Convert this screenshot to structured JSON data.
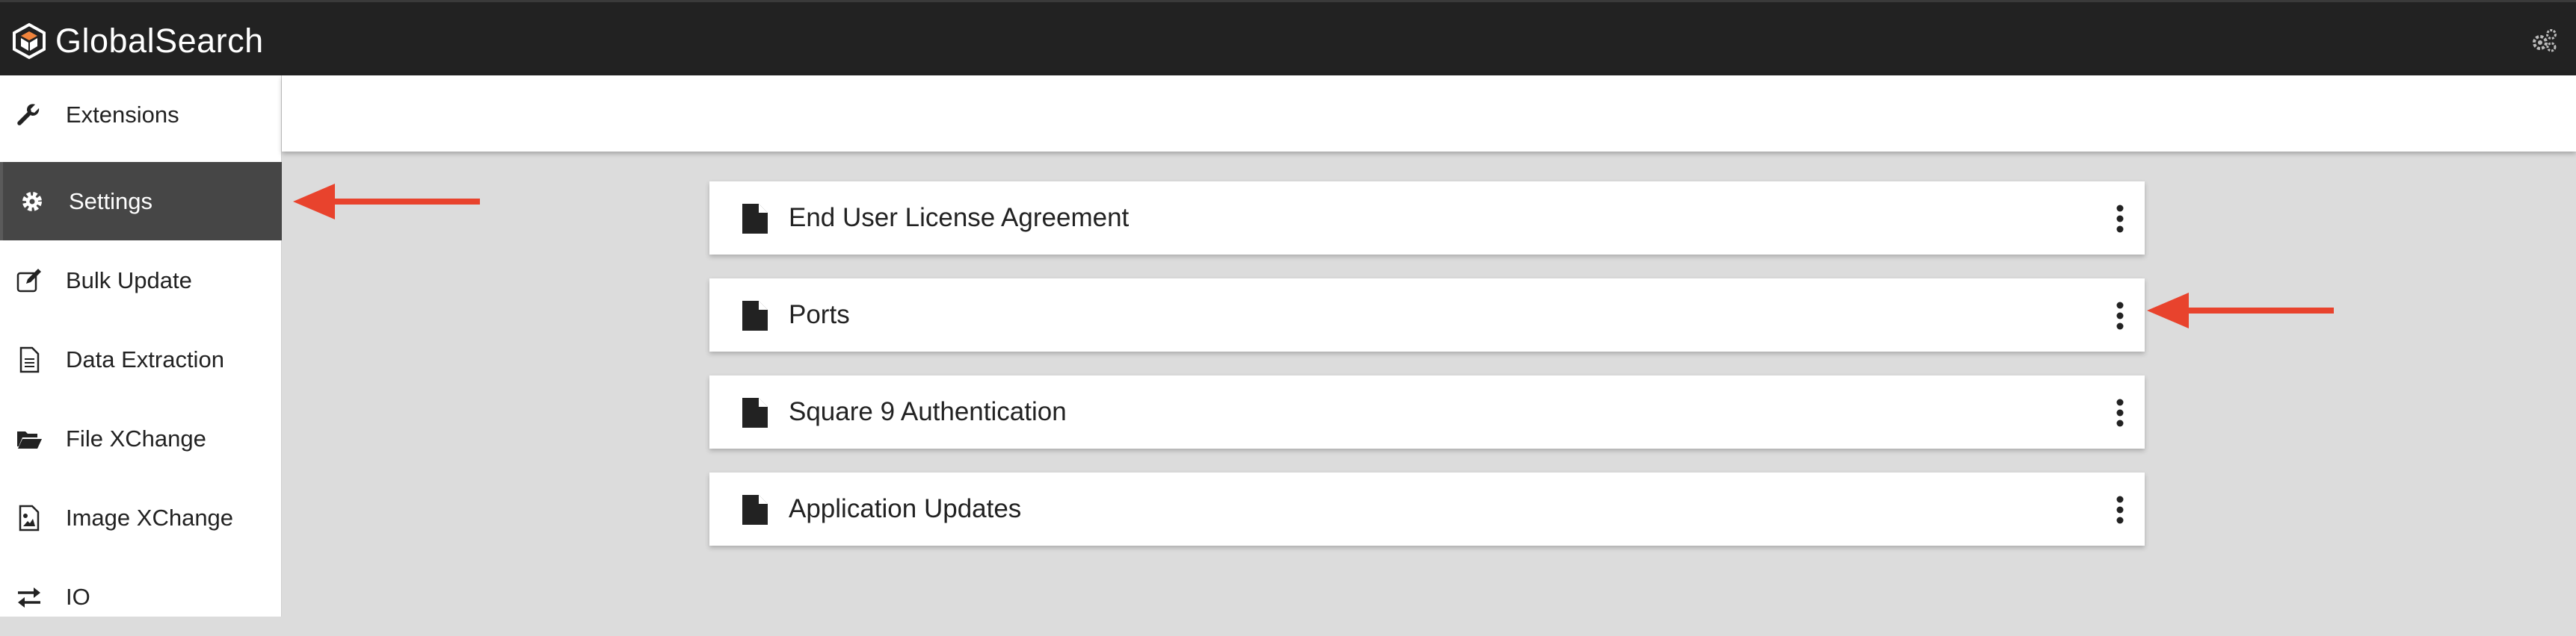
{
  "app": {
    "brand": "GlobalSearch"
  },
  "topbar": {
    "settings_icon": "gears-icon"
  },
  "sidebar": {
    "items": [
      {
        "label": "Extensions",
        "icon": "wrench-icon",
        "active": false
      },
      {
        "label": "Settings",
        "icon": "gear-icon",
        "active": true
      },
      {
        "label": "Bulk Update",
        "icon": "edit-icon",
        "active": false
      },
      {
        "label": "Data Extraction",
        "icon": "document-text-icon",
        "active": false
      },
      {
        "label": "File XChange",
        "icon": "folder-open-icon",
        "active": false
      },
      {
        "label": "Image XChange",
        "icon": "image-file-icon",
        "active": false
      },
      {
        "label": "IO",
        "icon": "exchange-arrows-icon",
        "active": false
      }
    ]
  },
  "main": {
    "cards": [
      {
        "title": "End User License Agreement",
        "icon": "file-icon",
        "menu_icon": "kebab-menu-icon"
      },
      {
        "title": "Ports",
        "icon": "file-icon",
        "menu_icon": "kebab-menu-icon"
      },
      {
        "title": "Square 9 Authentication",
        "icon": "file-icon",
        "menu_icon": "kebab-menu-icon"
      },
      {
        "title": "Application Updates",
        "icon": "file-icon",
        "menu_icon": "kebab-menu-icon"
      }
    ]
  },
  "annotations": {
    "arrow_color": "#e8432d"
  },
  "colors": {
    "topbar": "#222222",
    "active_item": "#464646",
    "background": "#dcdcdc"
  }
}
